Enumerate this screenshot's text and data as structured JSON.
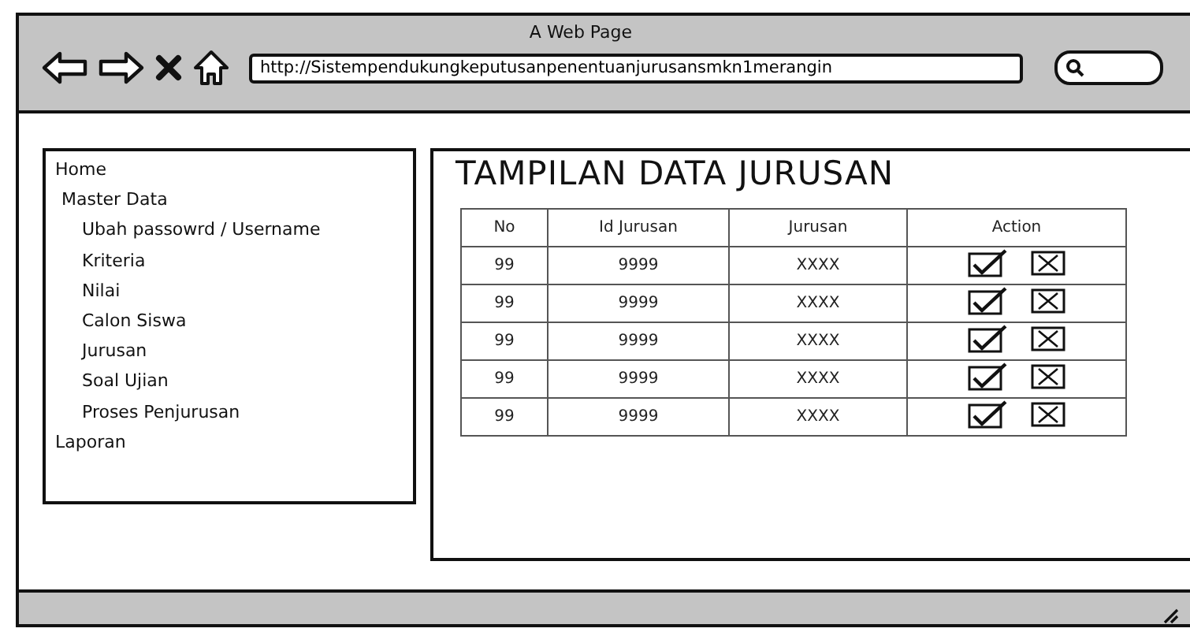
{
  "window": {
    "title": "A Web Page"
  },
  "browser": {
    "url": "http://Sistempendukungkeputusanpenentuanjurusansmkn1merangin"
  },
  "sidebar": {
    "items": [
      {
        "label": "Home"
      },
      {
        "label": "Master Data",
        "children": [
          {
            "label": "Ubah passowrd / Username"
          },
          {
            "label": "Kriteria"
          },
          {
            "label": "Nilai"
          },
          {
            "label": "Calon Siswa"
          },
          {
            "label": "Jurusan"
          },
          {
            "label": "Soal Ujian"
          },
          {
            "label": "Proses Penjurusan"
          }
        ]
      },
      {
        "label": "Laporan"
      }
    ]
  },
  "main": {
    "heading": "TAMPILAN DATA JURUSAN",
    "table": {
      "columns": [
        "No",
        "Id Jurusan",
        "Jurusan",
        "Action"
      ],
      "rows": [
        [
          "99",
          "9999",
          "XXXX"
        ],
        [
          "99",
          "9999",
          "XXXX"
        ],
        [
          "99",
          "9999",
          "XXXX"
        ],
        [
          "99",
          "9999",
          "XXXX"
        ],
        [
          "99",
          "9999",
          "XXXX"
        ]
      ]
    }
  }
}
